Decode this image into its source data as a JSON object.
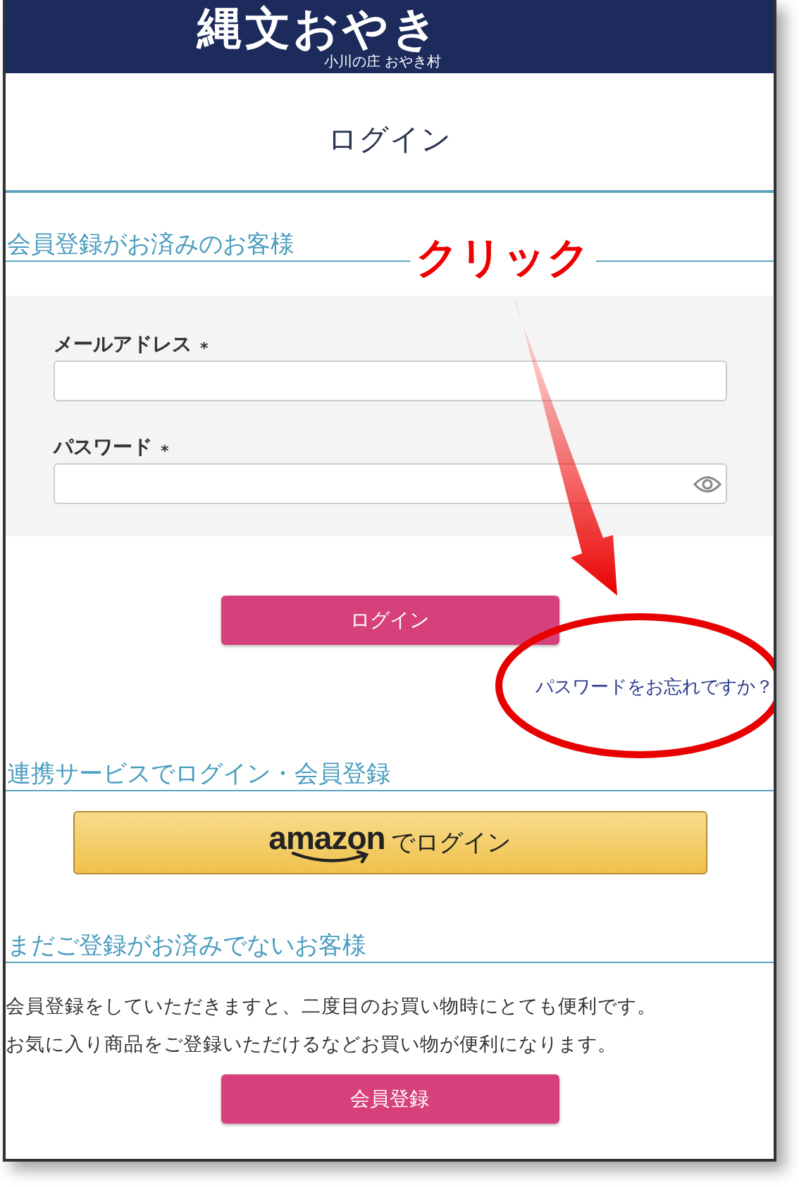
{
  "header": {
    "logo": "縄文おやき",
    "logo_subtitle": "小川の庄 おやき村"
  },
  "page_title": "ログイン",
  "member_section": {
    "heading": "会員登録がお済みのお客様",
    "fields": [
      {
        "label": "メールアドレス",
        "required_mark": "*",
        "kind": "text"
      },
      {
        "label": "パスワード",
        "required_mark": "*",
        "kind": "password"
      }
    ],
    "login_button": "ログイン",
    "forgot_link": "パスワードをお忘れですか？"
  },
  "social_section": {
    "heading": "連携サービスでログイン・会員登録",
    "amazon_button": {
      "logo": "amazon",
      "label": "でログイン"
    }
  },
  "guest_section": {
    "heading": "まだご登録がお済みでないお客様",
    "paragraphs": [
      "会員登録をしていただきますと、二度目のお買い物時にとても便利です。",
      "お気に入り商品をご登録いただけるなどお買い物が便利になります。"
    ],
    "register_button": "会員登録"
  },
  "annotation": {
    "callout": "クリック"
  }
}
